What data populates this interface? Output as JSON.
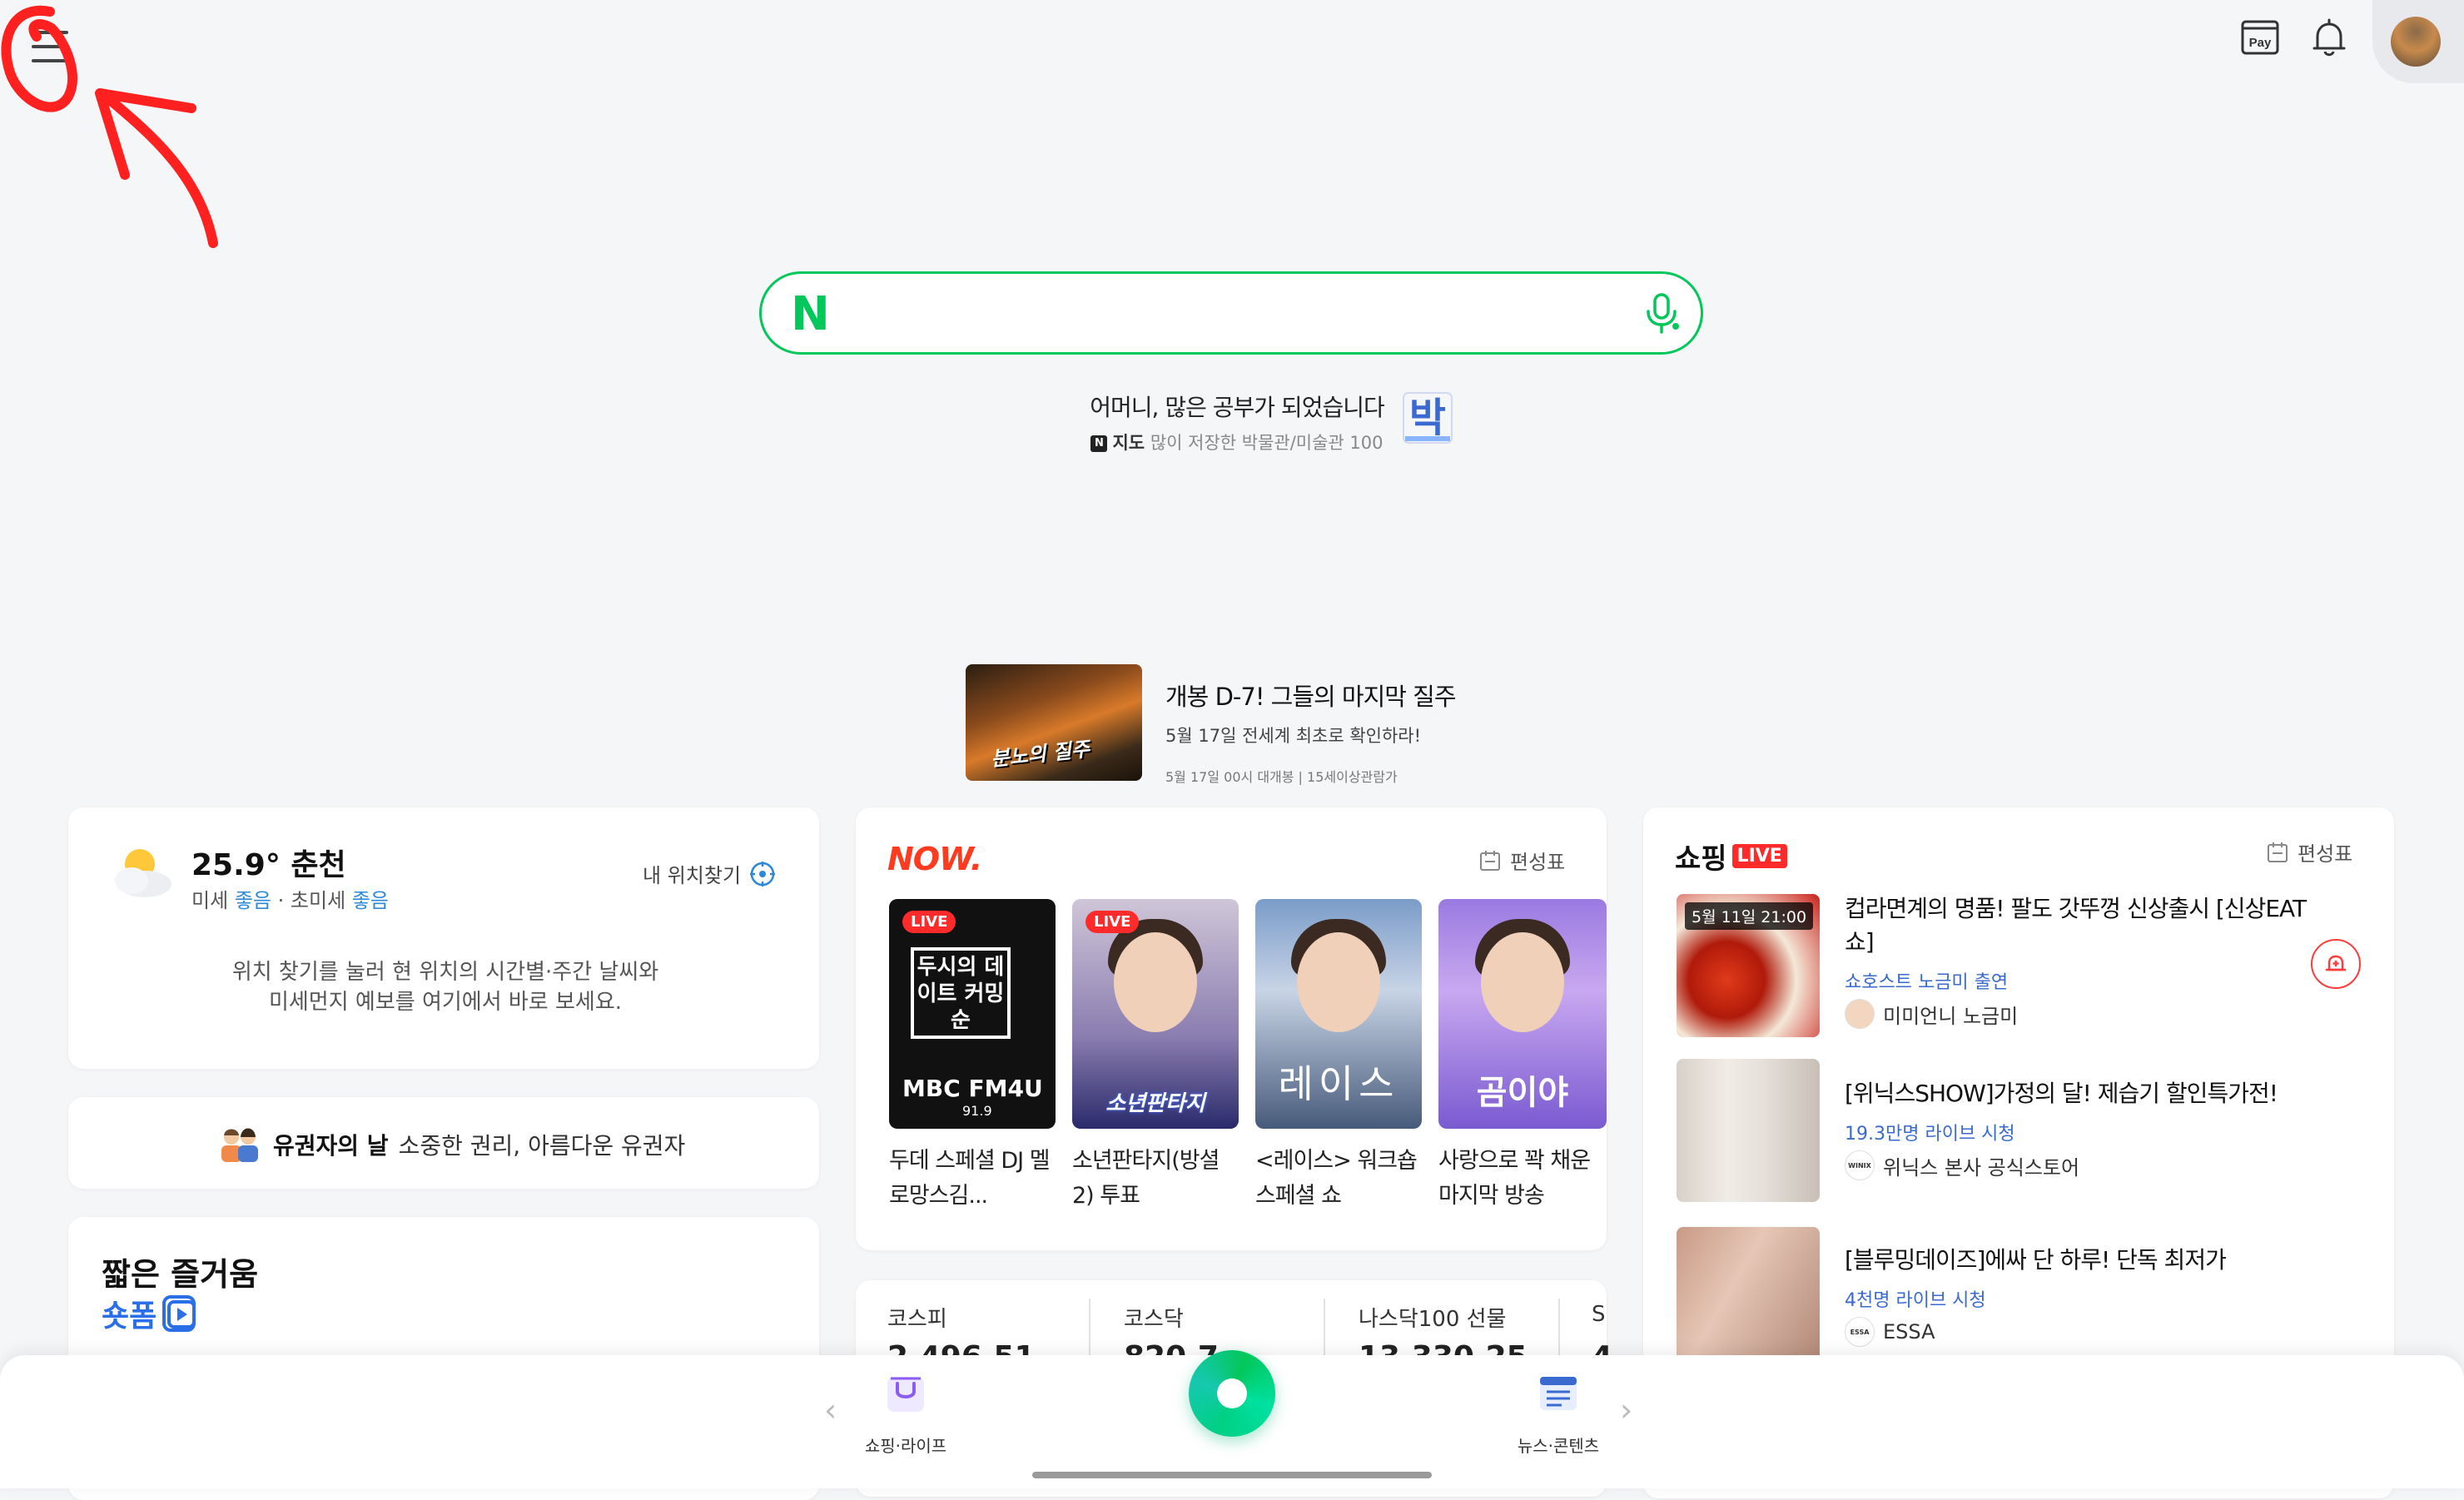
{
  "topbar": {
    "pay_label": "Pay"
  },
  "search": {
    "logo": "N",
    "placeholder": ""
  },
  "promo": {
    "title": "어머니, 많은 공부가 되었습니다",
    "sub_tag": "N",
    "sub_service": "지도",
    "sub_text": "많이 저장한 박물관/미술관 100",
    "icon_text": "박"
  },
  "ad": {
    "image_text": "분노의 질주",
    "title": "개봉 D-7! 그들의 마지막 질주",
    "sub": "5월 17일 전세계 최초로 확인하라!",
    "small": "5월 17일 00시 대개봉 | 15세이상관람가"
  },
  "weather": {
    "temp_location": "25.9° 춘천",
    "dust_label1": "미세",
    "dust_val1": "좋음",
    "dust_sep": "·",
    "dust_label2": "초미세",
    "dust_val2": "좋음",
    "find_location": "내 위치찾기",
    "desc_line1": "위치 찾기를 눌러 현 위치의 시간별·주간 날씨와",
    "desc_line2": "미세먼지 예보를 여기에서 바로 보세요."
  },
  "voter": {
    "bold": "유권자의 날",
    "text": "소중한 권리, 아름다운 유권자"
  },
  "shortform": {
    "title": "짧은 즐거움",
    "brand": "숏폼"
  },
  "now": {
    "logo": "NOW.",
    "schedule": "편성표",
    "live_badge": "LIVE",
    "items": [
      {
        "box_text": "두시의 데이트 커밍순",
        "brand": "MBC FM4U",
        "freq": "91.9",
        "caption": "두데 스페셜 DJ 멜로망스김..."
      },
      {
        "overlay": "소년판타지",
        "caption": "소년판타지(방셜2) 투표"
      },
      {
        "overlay": "레이스",
        "caption": "<레이스> 워크숍 스페셜 쇼"
      },
      {
        "overlay": "곰이야",
        "caption": "사랑으로 꽉 채운 마지막 방송"
      }
    ]
  },
  "stock": {
    "items": [
      {
        "label": "코스피",
        "value": "2,496.51"
      },
      {
        "label": "코스닥",
        "value": "820.7"
      },
      {
        "label": "나스닥100 선물",
        "value": "13,330.25"
      },
      {
        "label": "S",
        "value": "4"
      }
    ]
  },
  "shopping": {
    "logo": "쇼핑",
    "live": "LIVE",
    "schedule": "편성표",
    "items": [
      {
        "tag": "5월 11일 21:00",
        "title": "컵라면계의 명품! 팔도 갓뚜껑 신상출시 [신상EAT쇼]",
        "meta": "쇼호스트 노금미 출연",
        "seller": "미미언니 노금미"
      },
      {
        "title": "[위닉스SHOW]가정의 달! 제습기 할인특가전!",
        "meta": "19.3만명 라이브 시청",
        "seller_logo": "WINIX",
        "seller": "위닉스 본사 공식스토어"
      },
      {
        "title": "[블루밍데이즈]에싸 단 하루! 단독 최저가",
        "meta": "4천명 라이브 시청",
        "seller_logo": "ESSA",
        "seller": "ESSA"
      }
    ]
  },
  "bottom": {
    "left_label": "쇼핑·라이프",
    "right_label": "뉴스·콘텐츠"
  },
  "colors": {
    "naver_green": "#03c75a",
    "now_red": "#ff3b1f",
    "live_red": "#ff2a2a",
    "link_blue": "#2d88d8"
  }
}
